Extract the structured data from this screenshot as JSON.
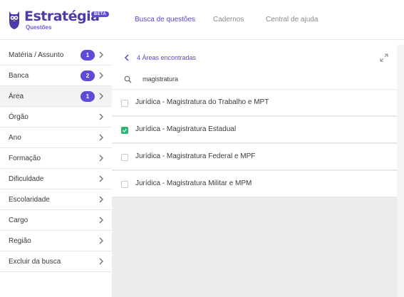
{
  "header": {
    "brand": "Estratégia",
    "brand_sub": "Questões",
    "badge": "BETA",
    "nav": [
      "Busca de questões",
      "Cadernos",
      "Central de ajuda"
    ]
  },
  "colors": {
    "accent": "#5d4bd6",
    "checked": "#2bb673"
  },
  "sidebar": {
    "filters": [
      {
        "label": "Matéria / Assunto",
        "count": "1"
      },
      {
        "label": "Banca",
        "count": "2"
      },
      {
        "label": "Área",
        "count": "1"
      },
      {
        "label": "Órgão"
      },
      {
        "label": "Ano"
      },
      {
        "label": "Formação"
      },
      {
        "label": "Dificuldade"
      },
      {
        "label": "Escolaridade"
      },
      {
        "label": "Cargo"
      },
      {
        "label": "Região"
      },
      {
        "label": "Excluir da busca"
      }
    ]
  },
  "panel": {
    "found": "4 Áreas encontradas",
    "search_value": "magistratura",
    "options": [
      {
        "label": "Jurídica - Magistratura do Trabalho e MPT",
        "checked": false
      },
      {
        "label": "Jurídica - Magistratura Estadual",
        "checked": true
      },
      {
        "label": "Jurídica - Magistratura Federal e MPF",
        "checked": false
      },
      {
        "label": "Jurídica - Magistratura Militar e MPM",
        "checked": false
      }
    ]
  }
}
